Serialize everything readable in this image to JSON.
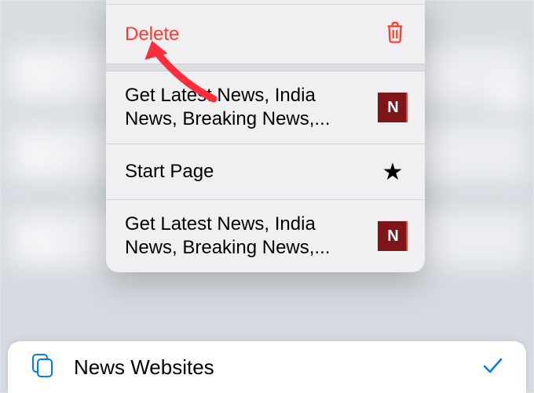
{
  "colors": {
    "destructive": "#ff3b30",
    "accent": "#007aff",
    "newsBrand": "#7d1519"
  },
  "contextMenu": {
    "delete": {
      "label": "Delete"
    },
    "items": [
      {
        "title": "Get Latest News, India News, Breaking News,...",
        "thumbType": "news",
        "thumbText": "N"
      },
      {
        "title": "Start Page",
        "thumbType": "star"
      },
      {
        "title": "Get Latest News, India News, Breaking News,...",
        "thumbType": "news",
        "thumbText": "N"
      }
    ]
  },
  "bottomItem": {
    "title": "News Websites",
    "selected": true
  }
}
